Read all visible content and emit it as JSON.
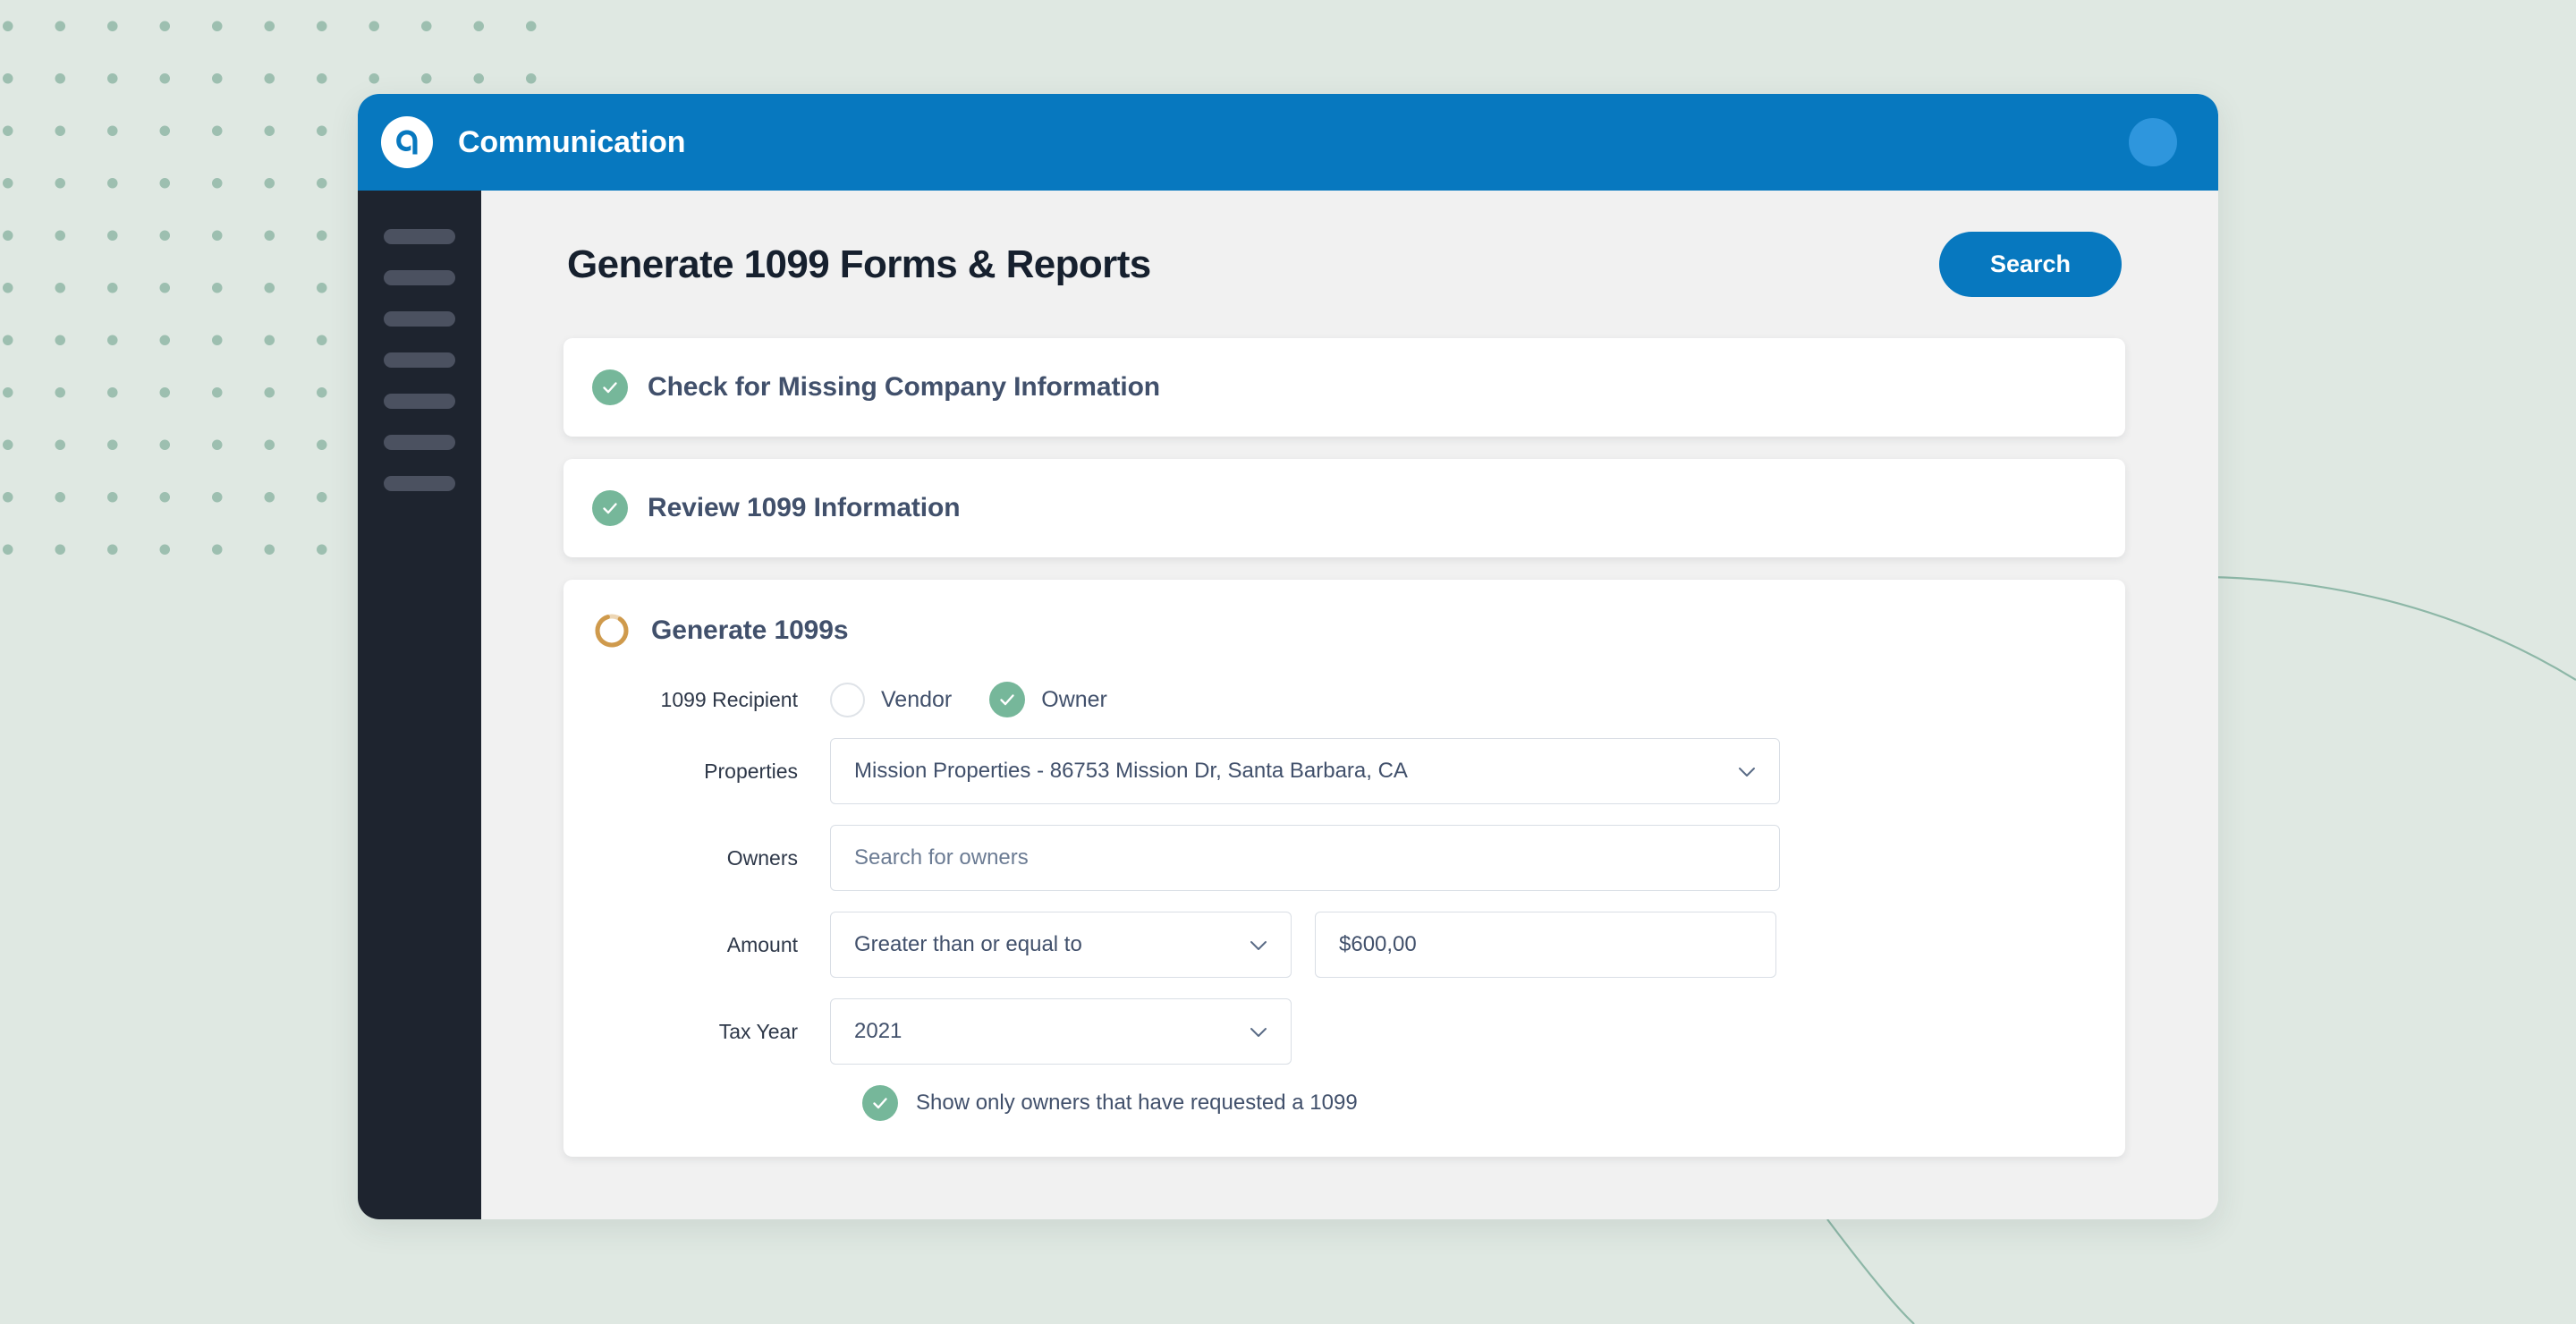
{
  "window": {
    "topbar": {
      "logo_icon": "appfolio-a-logo-icon",
      "title": "Communication",
      "avatar_icon": "user-avatar-icon"
    }
  },
  "sidebar": {
    "items": [
      {
        "label": ""
      },
      {
        "label": ""
      },
      {
        "label": ""
      },
      {
        "label": ""
      },
      {
        "label": ""
      },
      {
        "label": ""
      },
      {
        "label": ""
      }
    ]
  },
  "page": {
    "title": "Generate 1099 Forms & Reports",
    "search_label": "Search"
  },
  "steps": [
    {
      "icon": "check-circle-icon",
      "status": "complete",
      "title": "Check for Missing Company Information"
    },
    {
      "icon": "check-circle-icon",
      "status": "complete",
      "title": "Review 1099 Information"
    },
    {
      "icon": "progress-ring-icon",
      "status": "in-progress",
      "title": "Generate 1099s"
    }
  ],
  "form": {
    "recipient": {
      "label": "1099 Recipient",
      "options": [
        {
          "label": "Vendor",
          "selected": false
        },
        {
          "label": "Owner",
          "selected": true
        }
      ]
    },
    "properties": {
      "label": "Properties",
      "value": "Mission Properties - 86753 Mission Dr, Santa Barbara, CA",
      "chevron_icon": "chevron-down-icon"
    },
    "owners": {
      "label": "Owners",
      "value": "",
      "placeholder": "Search for owners"
    },
    "amount": {
      "label": "Amount",
      "operator": "Greater than or equal to",
      "operator_chevron_icon": "chevron-down-icon",
      "value": "$600,00"
    },
    "tax_year": {
      "label": "Tax Year",
      "value": "2021",
      "chevron_icon": "chevron-down-icon"
    },
    "requested_only": {
      "label": "Show only owners that have requested a 1099",
      "checked": true,
      "icon": "check-circle-icon"
    }
  },
  "colors": {
    "brand_blue": "#0778bf",
    "sidebar_dark": "#1e242f",
    "check_green": "#76b79a",
    "progress_gold": "#cf9a4c",
    "page_bg": "#dfe8e2",
    "text_navy": "#41506b"
  }
}
